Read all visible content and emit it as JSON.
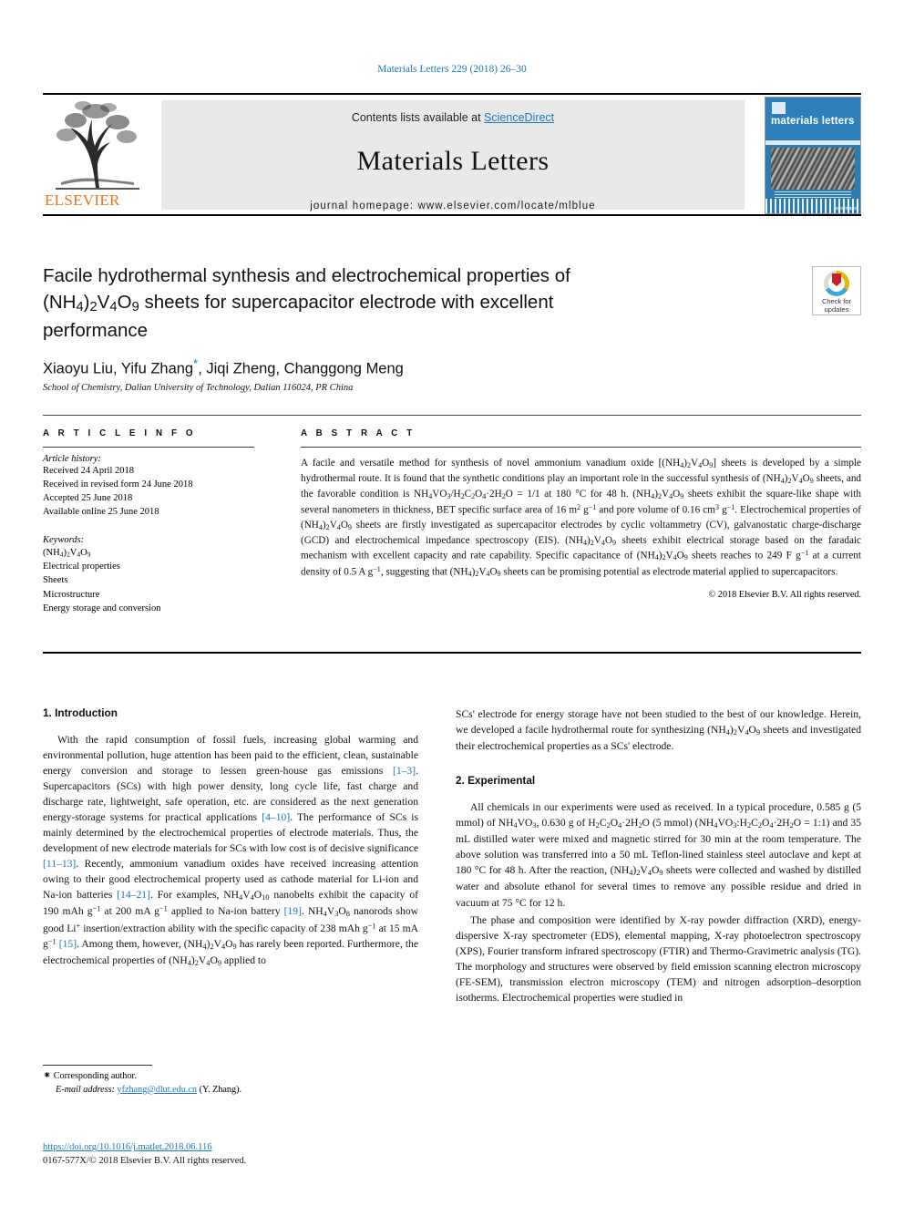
{
  "running_head": "Materials Letters 229 (2018) 26–30",
  "masthead": {
    "contents_prefix": "Contents lists available at ",
    "sciencedirect": "ScienceDirect",
    "journal_title": "Materials Letters",
    "homepage": "journal homepage: www.elsevier.com/locate/mlblue",
    "publisher_wordmark": "ELSEVIER",
    "cover_title": "materials letters",
    "cover_footer": "nanoimage"
  },
  "article": {
    "title_line1": "Facile hydrothermal synthesis and electrochemical properties of",
    "title_line2_html": "(NH<sub>4</sub>)<sub>2</sub>V<sub>4</sub>O<sub>9</sub> sheets for supercapacitor electrode with excellent",
    "title_line3": "performance",
    "authors": "Xiaoyu Liu, Yifu Zhang",
    "authors_tail": ", Jiqi Zheng, Changgong Meng",
    "corresponding_mark": "*",
    "affiliation": "School of Chemistry, Dalian University of Technology, Dalian 116024, PR China"
  },
  "crossmark": {
    "line1": "Check for",
    "line2": "updates"
  },
  "article_info": {
    "heading": "A R T I C L E   I N F O",
    "history_label": "Article history:",
    "history": [
      "Received 24 April 2018",
      "Received in revised form 24 June 2018",
      "Accepted 25 June 2018",
      "Available online 25 June 2018"
    ],
    "keywords_label": "Keywords:",
    "keywords_html": [
      "(NH<sub>4</sub>)<sub>2</sub>V<sub>4</sub>O<sub>9</sub>",
      "Electrical properties",
      "Sheets",
      "Microstructure",
      "Energy storage and conversion"
    ]
  },
  "abstract": {
    "heading": "A B S T R A C T",
    "body_html": "A facile and versatile method for synthesis of novel ammonium vanadium oxide [(NH<sub>4</sub>)<sub>2</sub>V<sub>4</sub>O<sub>9</sub>] sheets is developed by a simple hydrothermal route. It is found that the synthetic conditions play an important role in the successful synthesis of (NH<sub>4</sub>)<sub>2</sub>V<sub>4</sub>O<sub>9</sub> sheets, and the favorable condition is NH<sub>4</sub>VO<sub>3</sub>/H<sub>2</sub>C<sub>2</sub>O<sub>4</sub>·2H<sub>2</sub>O = 1/1 at 180 °C for 48 h. (NH<sub>4</sub>)<sub>2</sub>V<sub>4</sub>O<sub>9</sub> sheets exhibit the square-like shape with several nanometers in thickness, BET specific surface area of 16 m<sup>2</sup> g<sup>−1</sup> and pore volume of 0.16 cm<sup>3</sup> g<sup>−1</sup>. Electrochemical properties of (NH<sub>4</sub>)<sub>2</sub>V<sub>4</sub>O<sub>9</sub> sheets are firstly investigated as supercapacitor electrodes by cyclic voltammetry (CV), galvanostatic charge-discharge (GCD) and electrochemical impedance spectroscopy (EIS). (NH<sub>4</sub>)<sub>2</sub>V<sub>4</sub>O<sub>9</sub> sheets exhibit electrical storage based on the faradaic mechanism with excellent capacity and rate capability. Specific capacitance of (NH<sub>4</sub>)<sub>2</sub>V<sub>4</sub>O<sub>9</sub> sheets reaches to 249 F g<sup>−1</sup> at a current density of 0.5 A g<sup>−1</sup>, suggesting that (NH<sub>4</sub>)<sub>2</sub>V<sub>4</sub>O<sub>9</sub> sheets can be promising potential as electrode material applied to supercapacitors.",
    "copyright": "© 2018 Elsevier B.V. All rights reserved."
  },
  "sections": {
    "introduction_heading": "1. Introduction",
    "introduction_html": "With the rapid consumption of fossil fuels, increasing global warming and environmental pollution, huge attention has been paid to the efficient, clean, sustainable energy conversion and storage to lessen green-house gas emissions <span class=\"cite\">[1–3]</span>. Supercapacitors (SCs) with high power density, long cycle life, fast charge and discharge rate, lightweight, safe operation, etc. are considered as the next generation energy-storage systems for practical applications <span class=\"cite\">[4–10]</span>. The performance of SCs is mainly determined by the electrochemical properties of electrode materials. Thus, the development of new electrode materials for SCs with low cost is of decisive significance <span class=\"cite\">[11–13]</span>. Recently, ammonium vanadium oxides have received increasing attention owing to their good electrochemical property used as cathode material for Li-ion and Na-ion batteries <span class=\"cite\">[14–21]</span>. For examples, NH<sub>4</sub>V<sub>4</sub>O<sub>10</sub> nanobelts exhibit the capacity of 190 mAh g<sup>−1</sup> at 200 mA g<sup>−1</sup> applied to Na-ion battery <span class=\"cite\">[19]</span>. NH<sub>4</sub>V<sub>3</sub>O<sub>8</sub> nanorods show good Li<sup>+</sup> insertion/extraction ability with the specific capacity of 238 mAh g<sup>−1</sup> at 15 mA g<sup>−1</sup> <span class=\"cite\">[15]</span>. Among them, however, (NH<sub>4</sub>)<sub>2</sub>V<sub>4</sub>O<sub>9</sub> has rarely been reported. Furthermore, the electrochemical properties of (NH<sub>4</sub>)<sub>2</sub>V<sub>4</sub>O<sub>9</sub> applied to",
    "introduction_cont_html": "SCs' electrode for energy storage have not been studied to the best of our knowledge. Herein, we developed a facile hydrothermal route for synthesizing (NH<sub>4</sub>)<sub>2</sub>V<sub>4</sub>O<sub>9</sub> sheets and investigated their electrochemical properties as a SCs' electrode.",
    "experimental_heading": "2. Experimental",
    "experimental_p1_html": "All chemicals in our experiments were used as received. In a typical procedure, 0.585 g (5 mmol) of NH<sub>4</sub>VO<sub>3</sub>, 0.630 g of H<sub>2</sub>C<sub>2</sub>O<sub>4</sub>·2H<sub>2</sub>O (5 mmol) (NH<sub>4</sub>VO<sub>3</sub>:H<sub>2</sub>C<sub>2</sub>O<sub>4</sub>·2H<sub>2</sub>O = 1:1) and 35 mL distilled water were mixed and magnetic stirred for 30 min at the room temperature. The above solution was transferred into a 50 mL Teflon-lined stainless steel autoclave and kept at 180 °C for 48 h. After the reaction, (NH<sub>4</sub>)<sub>2</sub>V<sub>4</sub>O<sub>9</sub> sheets were collected and washed by distilled water and absolute ethanol for several times to remove any possible residue and dried in vacuum at 75 °C for 12 h.",
    "experimental_p2_html": "The phase and composition were identified by X-ray powder diffraction (XRD), energy-dispersive X-ray spectrometer (EDS), elemental mapping, X-ray photoelectron spectroscopy (XPS), Fourier transform infrared spectroscopy (FTIR) and Thermo-Gravimetric analysis (TG). The morphology and structures were observed by field emission scanning electron microscopy (FE-SEM), transmission electron microscopy (TEM) and nitrogen adsorption–desorption isotherms. Electrochemical properties were studied in"
  },
  "footnote": {
    "corresponding_star": "⁕",
    "corresponding_text": "Corresponding author.",
    "email_label": "E-mail address:",
    "email": "yfzhang@dlut.edu.cn",
    "email_suffix": "(Y. Zhang).",
    "doi": "https://doi.org/10.1016/j.matlet.2018.06.116",
    "issn": "0167-577X/© 2018 Elsevier B.V. All rights reserved."
  },
  "colors": {
    "link_blue": "#1a7bb9",
    "elsevier_orange": "#e87722",
    "cover_blue": "#2b7cb5"
  }
}
